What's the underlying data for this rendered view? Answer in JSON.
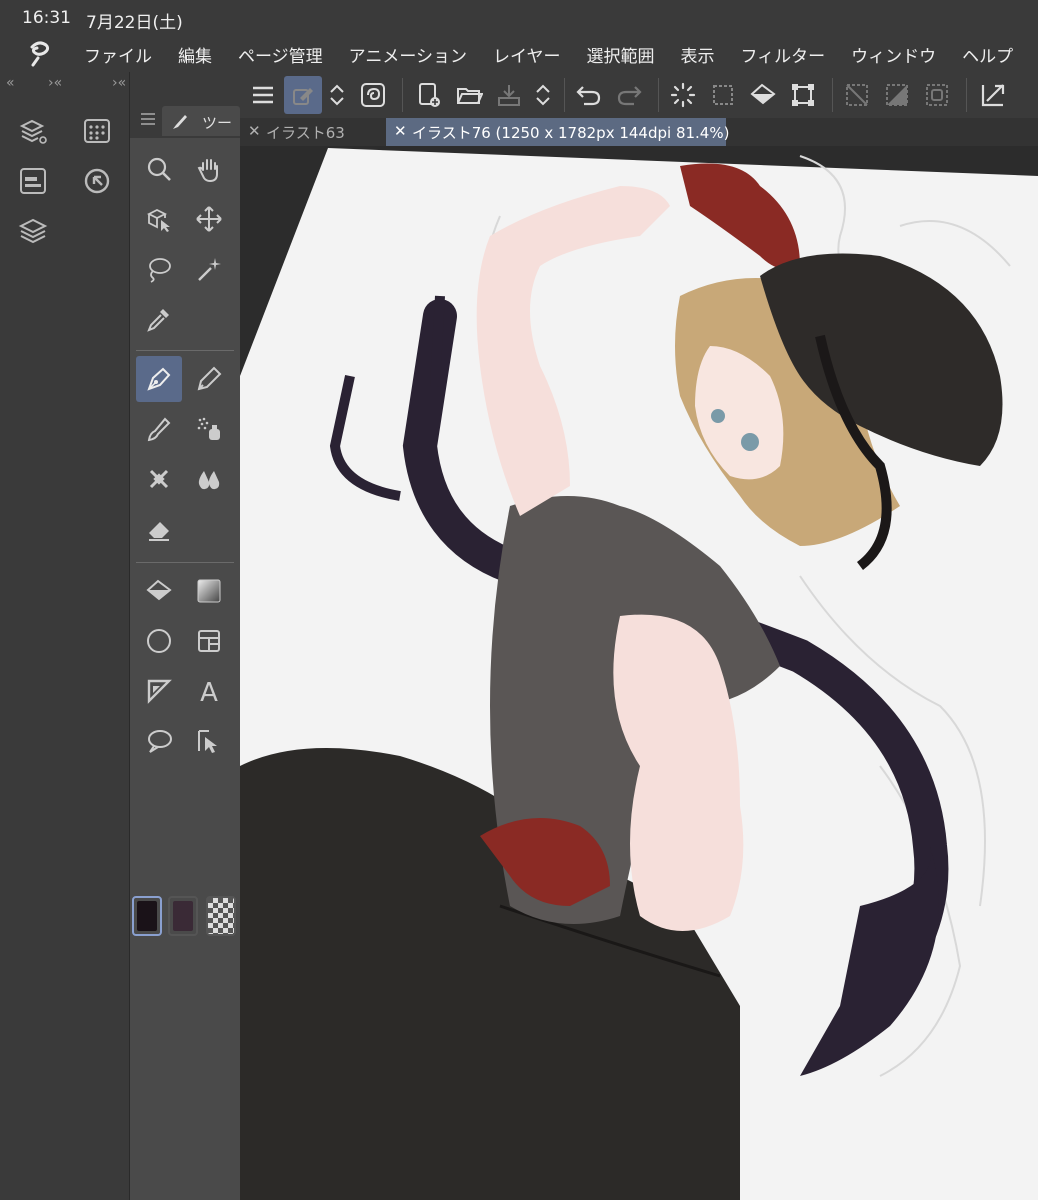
{
  "status_bar": {
    "time": "16:31",
    "date": "7月22日(土)"
  },
  "menu": {
    "items": [
      "ファイル",
      "編集",
      "ページ管理",
      "アニメーション",
      "レイヤー",
      "選択範囲",
      "表示",
      "フィルター",
      "ウィンドウ",
      "ヘルプ"
    ]
  },
  "left_panel": {
    "collapse_left": "«",
    "collapse_mid": "›«",
    "collapse_right": "›«"
  },
  "tool_panel": {
    "tab_label": "ツー"
  },
  "doc_tabs": [
    {
      "close": "✕",
      "name": "イラスト63"
    },
    {
      "close": "✕",
      "name": "イラスト76 (1250 x 1782px 144dpi 81.4%)"
    }
  ],
  "colors": {
    "main_color": "#1a1218",
    "sub_color": "#3a2a36",
    "accent": "#5a6a8a"
  },
  "icons": {
    "left_panel": [
      "layer-property-icon",
      "sub-tool-detail-icon",
      "navigator-icon",
      "material-icon",
      "layers-icon",
      "quick-access-icon"
    ],
    "tools": [
      "zoom-icon",
      "hand-icon",
      "object-icon",
      "move-icon",
      "lasso-icon",
      "magic-wand-icon",
      "eyedropper-icon",
      "pen-icon",
      "pencil-icon",
      "brush-icon",
      "airbrush-icon",
      "decoration-icon",
      "blend-icon",
      "eraser-icon",
      "fill-icon",
      "gradient-icon",
      "figure-icon",
      "frame-icon",
      "ruler-icon",
      "text-icon",
      "balloon-icon",
      "correct-line-icon"
    ]
  }
}
